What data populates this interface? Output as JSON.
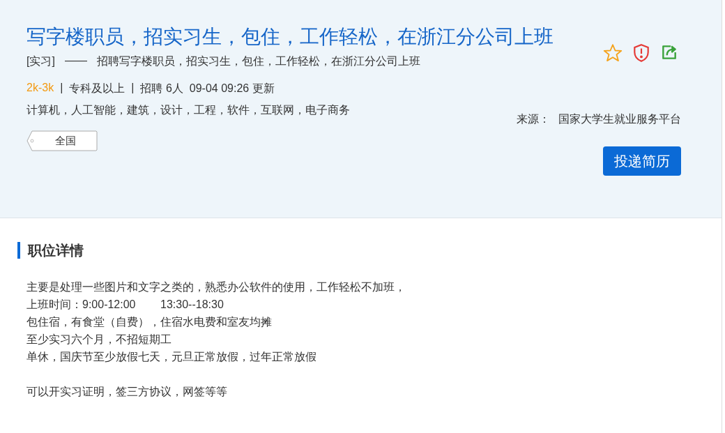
{
  "job": {
    "title": "写字楼职员，招实习生，包住，工作轻松，在浙江分公司上班",
    "type": "[实习]",
    "dash": "——",
    "summary": "招聘写字楼职员，招实习生，包住，工作轻松，在浙江分公司上班",
    "meta": [
      {
        "kind": "salary",
        "text": "2k-3k"
      },
      {
        "kind": "separator",
        "text": "|"
      },
      {
        "kind": "plain",
        "text": "专科及以上"
      },
      {
        "kind": "separator",
        "text": "|"
      },
      {
        "kind": "plain",
        "text": "招聘 6人"
      },
      {
        "kind": "plain",
        "text": "09-04 09:26 更新"
      }
    ],
    "majors": "计算机，人工智能，建筑，设计，工程，软件，互联网，电子商务",
    "location": "全国",
    "source_label": "来源：",
    "source": "国家大学生就业服务平台",
    "apply_button": "投递简历"
  },
  "details": {
    "heading": "职位详情",
    "paragraphs": [
      [
        "主要是处理一些图片和文字之类的，熟悉办公软件的使用，工作轻松不加班，",
        "上班时间：9:00-12:00        13:30--18:30",
        "包住宿，有食堂（自费），住宿水电费和室友均摊",
        "至少实习六个月，不招短期工",
        "单休，国庆节至少放假七天，元旦正常放假，过年正常放假"
      ],
      [
        "可以开实习证明，签三方协议，网签等等"
      ]
    ]
  }
}
